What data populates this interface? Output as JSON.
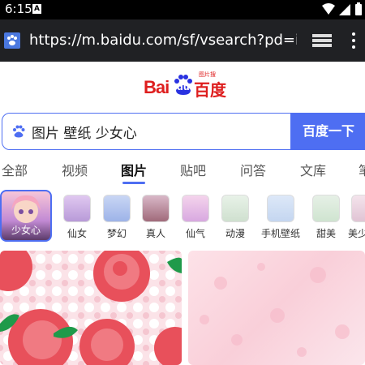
{
  "status": {
    "time": "6:15",
    "notification_icon": "A"
  },
  "browser": {
    "url": "https://m.baidu.com/sf/vsearch?pd=ima",
    "tabs_icon": "tabs-icon",
    "menu_icon": "more-icon"
  },
  "logo": {
    "part1": "Bai",
    "part2": "du",
    "part3": "百度",
    "sub": "图片搜"
  },
  "search": {
    "query": "图片 壁纸 少女心",
    "button": "百度一下"
  },
  "tabs": [
    {
      "label": "全部",
      "active": false
    },
    {
      "label": "视频",
      "active": false
    },
    {
      "label": "图片",
      "active": true
    },
    {
      "label": "贴吧",
      "active": false
    },
    {
      "label": "问答",
      "active": false
    },
    {
      "label": "文库",
      "active": false
    },
    {
      "label": "笔",
      "active": false
    }
  ],
  "categories": [
    {
      "label": "少女心",
      "selected": true
    },
    {
      "label": "仙女"
    },
    {
      "label": "梦幻"
    },
    {
      "label": "真人"
    },
    {
      "label": "仙气"
    },
    {
      "label": "动漫"
    },
    {
      "label": "手机壁纸"
    },
    {
      "label": "甜美"
    },
    {
      "label": "美少"
    }
  ],
  "colors": {
    "accent": "#4e6ef2",
    "brand_red": "#de1e1e",
    "status_bg": "#000000",
    "urlbar_bg": "#202124"
  }
}
